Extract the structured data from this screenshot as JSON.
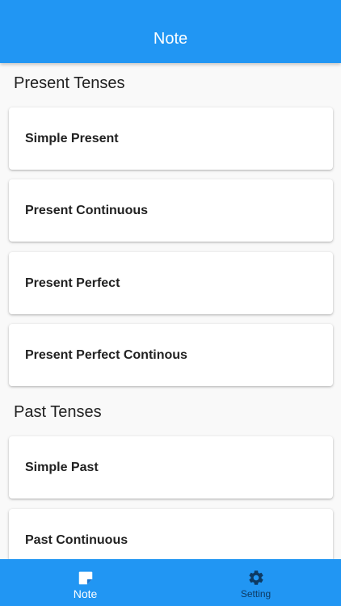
{
  "appbar": {
    "title": "Note"
  },
  "sections": [
    {
      "header": "Present Tenses",
      "items": [
        "Simple Present",
        "Present Continuous",
        "Present Perfect",
        "Present Perfect Continous"
      ]
    },
    {
      "header": "Past Tenses",
      "items": [
        "Simple Past",
        "Past Continuous"
      ]
    }
  ],
  "bottom_nav": {
    "items": [
      {
        "label": "Note",
        "icon": "note-icon",
        "selected": true
      },
      {
        "label": "Setting",
        "icon": "gear-icon",
        "selected": false
      }
    ]
  },
  "colors": {
    "primary": "#2196f3",
    "inactive_nav": "#0d3a63",
    "background": "#f9f9f9"
  }
}
